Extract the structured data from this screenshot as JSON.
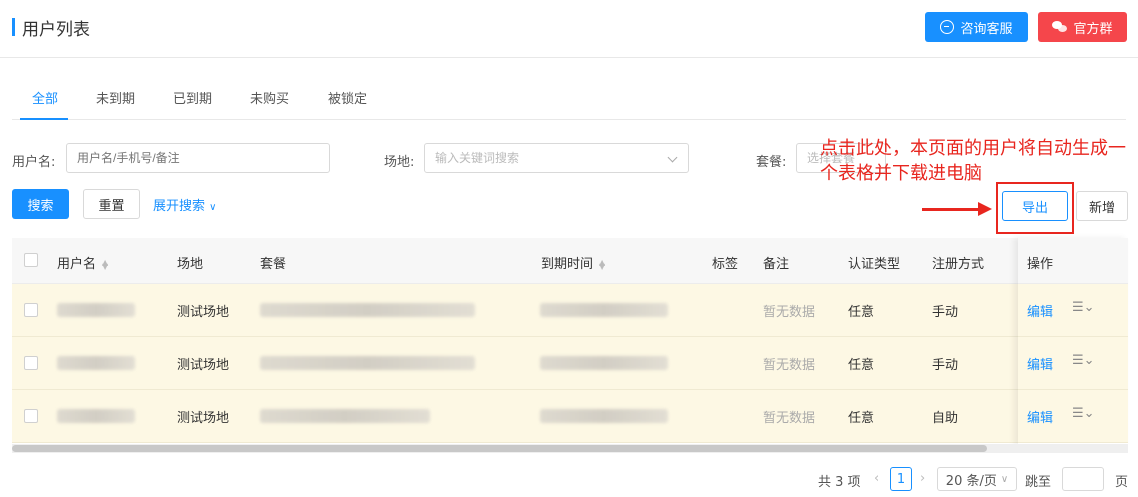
{
  "header": {
    "title": "用户列表",
    "consult_label": "咨询客服",
    "group_label": "官方群"
  },
  "tabs": [
    "全部",
    "未到期",
    "已到期",
    "未购买",
    "被锁定"
  ],
  "search": {
    "username_label": "用户名:",
    "username_placeholder": "用户名/手机号/备注",
    "venue_label": "场地:",
    "venue_placeholder": "输入关键词搜索",
    "package_label": "套餐:",
    "package_placeholder": "选择套餐",
    "search_btn": "搜索",
    "reset_btn": "重置",
    "expand_link": "展开搜索"
  },
  "actions": {
    "export_btn": "导出",
    "add_btn": "新增"
  },
  "annotation": "点击此处，本页面的用户将自动生成一个表格并下载进电脑",
  "table": {
    "columns": [
      "用户名",
      "场地",
      "套餐",
      "到期时间",
      "标签",
      "备注",
      "认证类型",
      "注册方式",
      "操作"
    ],
    "rows": [
      {
        "venue": "测试场地",
        "remark": "暂无数据",
        "auth": "任意",
        "reg": "手动",
        "edit": "编辑"
      },
      {
        "venue": "测试场地",
        "remark": "暂无数据",
        "auth": "任意",
        "reg": "手动",
        "edit": "编辑"
      },
      {
        "venue": "测试场地",
        "remark": "暂无数据",
        "auth": "任意",
        "reg": "自助",
        "edit": "编辑"
      }
    ]
  },
  "pagination": {
    "total": "共 3 项",
    "current_page": "1",
    "page_size": "20 条/页",
    "jump_label": "跳至",
    "page_suffix": "页"
  },
  "colors": {
    "primary": "#1890ff",
    "danger": "#f5464b",
    "annotation": "#e8261f",
    "row_highlight": "#fdf8e4"
  }
}
